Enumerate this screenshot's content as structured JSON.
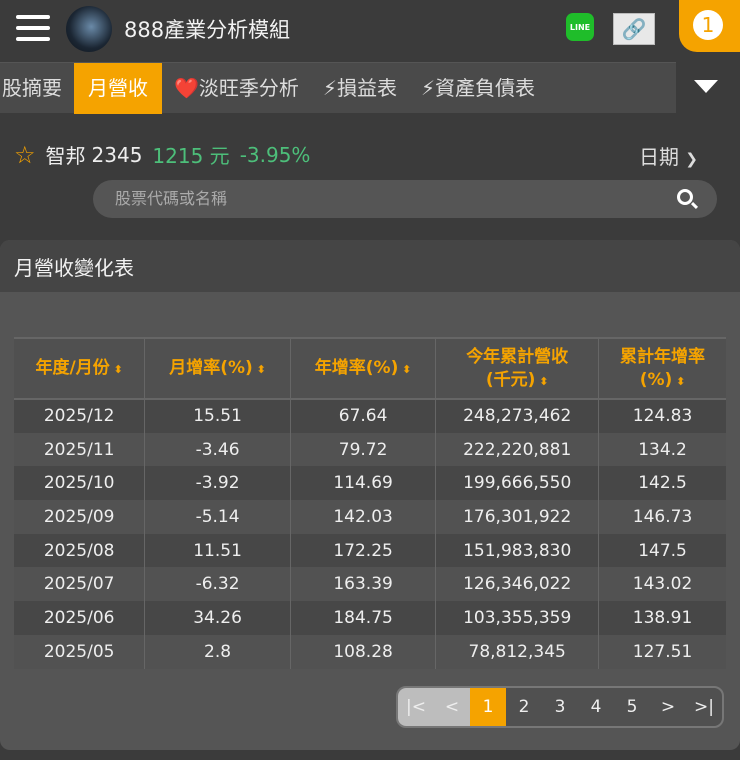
{
  "header": {
    "title": "888產業分析模組",
    "line_label": "LINE",
    "notification_count": "1"
  },
  "tabs": [
    {
      "label": "股摘要"
    },
    {
      "label": "月營收",
      "active": true
    },
    {
      "label": "❤️淡旺季分析"
    },
    {
      "label": "⚡損益表"
    },
    {
      "label": "⚡資產負債表"
    }
  ],
  "stock": {
    "name": "智邦",
    "code": "2345",
    "price": "1215 元",
    "change": "-3.95%",
    "sort_label": "日期"
  },
  "search": {
    "placeholder": "股票代碼或名稱"
  },
  "panel": {
    "title": "月營收變化表"
  },
  "table": {
    "columns": [
      "年度/月份",
      "月增率(%)",
      "年增率(%)",
      "今年累計營收\n(千元)",
      "累計年增率\n(%)"
    ],
    "rows": [
      [
        "2025/12",
        "15.51",
        "67.64",
        "248,273,462",
        "124.83"
      ],
      [
        "2025/11",
        "-3.46",
        "79.72",
        "222,220,881",
        "134.2"
      ],
      [
        "2025/10",
        "-3.92",
        "114.69",
        "199,666,550",
        "142.5"
      ],
      [
        "2025/09",
        "-5.14",
        "142.03",
        "176,301,922",
        "146.73"
      ],
      [
        "2025/08",
        "11.51",
        "172.25",
        "151,983,830",
        "147.5"
      ],
      [
        "2025/07",
        "-6.32",
        "163.39",
        "126,346,022",
        "143.02"
      ],
      [
        "2025/06",
        "34.26",
        "184.75",
        "103,355,359",
        "138.91"
      ],
      [
        "2025/05",
        "2.8",
        "108.28",
        "78,812,345",
        "127.51"
      ]
    ]
  },
  "pagination": {
    "items": [
      "|<",
      "<",
      "1",
      "2",
      "3",
      "4",
      "5",
      ">",
      ">|"
    ],
    "current": "1"
  },
  "colors": {
    "accent": "#f5a300",
    "positive": "#4dbf7a"
  }
}
